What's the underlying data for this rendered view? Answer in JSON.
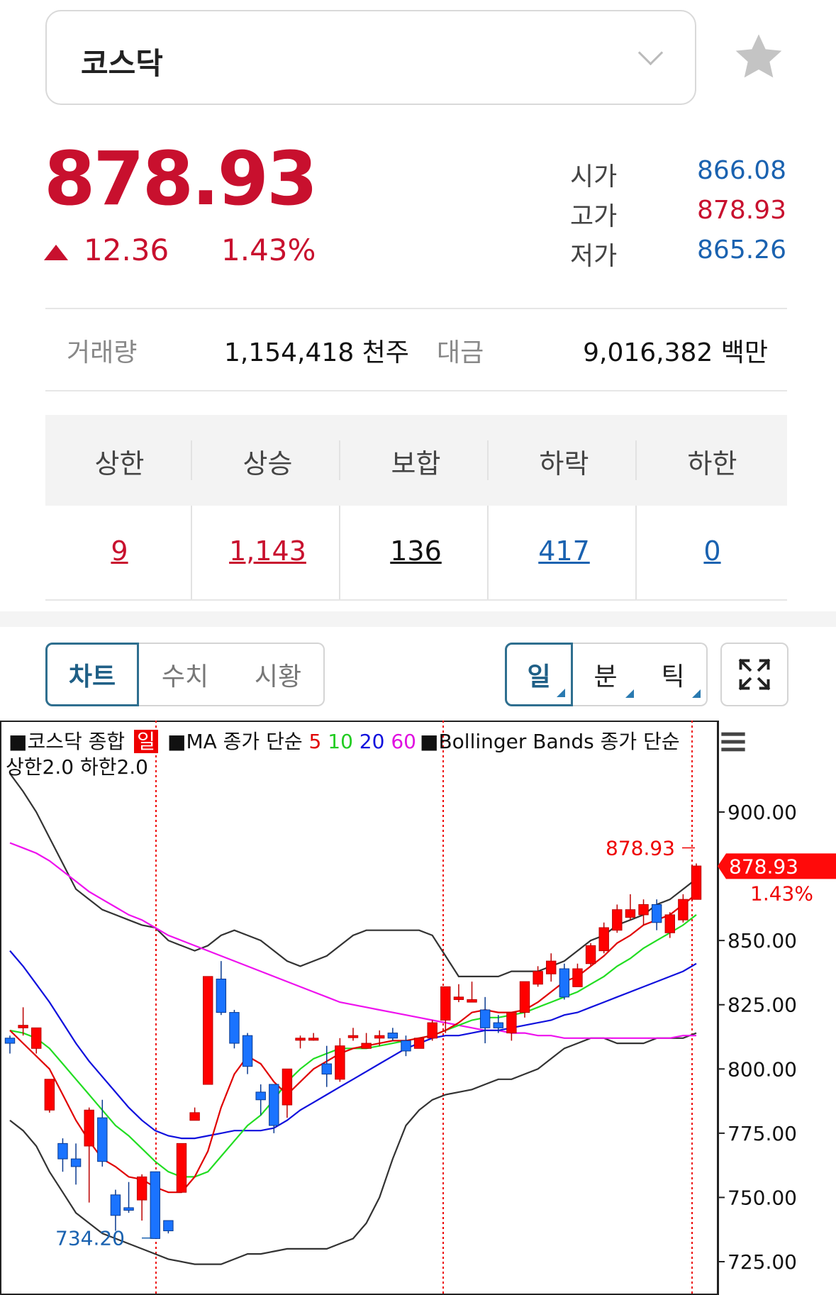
{
  "header": {
    "index_name": "코스닥"
  },
  "quote": {
    "price": "878.93",
    "change": "12.36",
    "change_pct": "1.43%",
    "open_label": "시가",
    "open": "866.08",
    "high_label": "고가",
    "high": "878.93",
    "low_label": "저가",
    "low": "865.26"
  },
  "volume": {
    "volume_label": "거래량",
    "volume_value": "1,154,418 천주",
    "amount_label": "대금",
    "amount_value": "9,016,382 백만"
  },
  "breadth": {
    "headers": [
      "상한",
      "상승",
      "보합",
      "하락",
      "하한"
    ],
    "values": [
      "9",
      "1,143",
      "136",
      "417",
      "0"
    ]
  },
  "chart_tabs": {
    "chart": "차트",
    "numbers": "수치",
    "market": "시황"
  },
  "period_tabs": {
    "day": "일",
    "minute": "분",
    "tick": "틱"
  },
  "legend": {
    "series": "■코스닥 종합",
    "period_badge": "일",
    "ma": "■MA 종가 단순",
    "ma5": "5",
    "ma10": "10",
    "ma20": "20",
    "ma60": "60",
    "bb": "■Bollinger Bands 종가 단순",
    "bb2": "상한2.0 하한2.0"
  },
  "colors": {
    "up": "#c8102e",
    "down": "#1a62b0",
    "candle_up": "#ff0000",
    "candle_down": "#1a73ff"
  },
  "chart_data": {
    "type": "candlestick",
    "y_ticks": [
      "900.00",
      "850.00",
      "825.00",
      "800.00",
      "775.00",
      "750.00",
      "725.00"
    ],
    "ylim": [
      722,
      912
    ],
    "last_price_label": "878.93",
    "last_pct_label": "1.43%",
    "high_marker": "878.93",
    "low_marker": "734.20",
    "candles": [
      [
        812,
        810,
        813,
        806
      ],
      [
        816,
        817,
        824,
        813
      ],
      [
        808,
        816,
        816,
        806
      ],
      [
        784,
        796,
        796,
        783
      ],
      [
        771,
        765,
        773,
        760
      ],
      [
        765,
        762,
        771,
        755
      ],
      [
        770,
        784,
        785,
        748
      ],
      [
        781,
        764,
        788,
        762
      ],
      [
        751,
        743,
        753,
        737
      ],
      [
        746,
        745,
        756,
        744
      ],
      [
        749,
        758,
        759,
        741
      ],
      [
        760,
        734,
        760,
        734
      ],
      [
        741,
        737,
        741,
        736
      ],
      [
        752,
        771,
        771,
        752
      ],
      [
        780,
        783,
        785,
        780
      ],
      [
        794,
        836,
        836,
        794
      ],
      [
        835,
        822,
        842,
        821
      ],
      [
        822,
        810,
        823,
        808
      ],
      [
        813,
        801,
        814,
        798
      ],
      [
        791,
        788,
        794,
        782
      ],
      [
        794,
        778,
        794,
        775
      ],
      [
        786,
        800,
        800,
        781
      ],
      [
        812,
        812,
        813,
        808
      ],
      [
        812,
        812,
        814,
        811
      ],
      [
        802,
        798,
        809,
        793
      ],
      [
        796,
        809,
        812,
        795
      ],
      [
        813,
        813,
        816,
        811
      ],
      [
        808,
        810,
        814,
        808
      ],
      [
        812,
        813,
        815,
        809
      ],
      [
        814,
        812,
        816,
        811
      ],
      [
        811,
        807,
        813,
        805
      ],
      [
        808,
        812,
        812,
        808
      ],
      [
        812,
        818,
        819,
        811
      ],
      [
        819,
        832,
        832,
        814
      ],
      [
        827,
        828,
        833,
        826
      ],
      [
        826,
        827,
        834,
        826
      ],
      [
        823,
        816,
        828,
        810
      ],
      [
        818,
        816,
        821,
        814
      ],
      [
        814,
        822,
        822,
        811
      ],
      [
        822,
        834,
        834,
        820
      ],
      [
        833,
        838,
        840,
        832
      ],
      [
        837,
        842,
        845,
        834
      ],
      [
        839,
        828,
        841,
        827
      ],
      [
        832,
        839,
        841,
        832
      ],
      [
        841,
        848,
        849,
        840
      ],
      [
        846,
        855,
        857,
        845
      ],
      [
        854,
        862,
        864,
        853
      ],
      [
        859,
        862,
        868,
        858
      ],
      [
        860,
        864,
        866,
        856
      ],
      [
        864,
        857,
        866,
        854
      ],
      [
        853,
        860,
        861,
        851
      ],
      [
        858,
        866,
        868,
        857
      ],
      [
        866,
        879,
        880,
        866
      ]
    ],
    "ma5": [
      815,
      810,
      805,
      800,
      790,
      780,
      772,
      765,
      762,
      758,
      757,
      754,
      752,
      752,
      758,
      768,
      785,
      798,
      805,
      802,
      795,
      790,
      795,
      800,
      803,
      806,
      808,
      809,
      810,
      811,
      811,
      812,
      813,
      815,
      818,
      822,
      823,
      822,
      822,
      823,
      826,
      830,
      834,
      836,
      840,
      844,
      849,
      852,
      856,
      858,
      860,
      864,
      868
    ],
    "ma10": [
      815,
      814,
      812,
      808,
      802,
      796,
      790,
      784,
      778,
      774,
      769,
      764,
      760,
      758,
      758,
      760,
      766,
      772,
      778,
      782,
      788,
      795,
      800,
      804,
      806,
      808,
      808,
      808,
      809,
      810,
      811,
      812,
      813,
      815,
      817,
      819,
      820,
      820,
      821,
      822,
      824,
      826,
      828,
      830,
      833,
      836,
      840,
      843,
      847,
      850,
      853,
      856,
      860
    ],
    "ma20": [
      846,
      840,
      833,
      826,
      818,
      810,
      803,
      797,
      791,
      785,
      780,
      776,
      774,
      773,
      773,
      774,
      775,
      776,
      776,
      776,
      777,
      780,
      784,
      787,
      790,
      793,
      796,
      799,
      802,
      805,
      808,
      810,
      812,
      813,
      813,
      814,
      815,
      815,
      816,
      817,
      818,
      819,
      821,
      822,
      824,
      826,
      828,
      830,
      832,
      834,
      836,
      838,
      841
    ],
    "ma60": [
      888,
      886,
      884,
      881,
      877,
      873,
      869,
      866,
      863,
      860,
      858,
      855,
      852,
      850,
      848,
      846,
      844,
      842,
      840,
      838,
      836,
      834,
      832,
      830,
      828,
      826,
      825,
      824,
      823,
      822,
      821,
      820,
      819,
      818,
      817,
      816,
      815,
      815,
      814,
      814,
      813,
      813,
      812,
      812,
      812,
      812,
      812,
      812,
      812,
      812,
      812,
      813,
      813
    ],
    "bb_upper": [
      915,
      908,
      900,
      890,
      880,
      870,
      866,
      862,
      860,
      858,
      856,
      855,
      850,
      848,
      846,
      848,
      852,
      854,
      852,
      850,
      846,
      842,
      840,
      842,
      844,
      848,
      852,
      854,
      854,
      854,
      854,
      854,
      852,
      844,
      836,
      836,
      836,
      836,
      838,
      838,
      838,
      840,
      842,
      846,
      850,
      852,
      856,
      858,
      860,
      864,
      866,
      870,
      874
    ],
    "bb_lower": [
      780,
      776,
      770,
      760,
      752,
      744,
      740,
      736,
      734,
      732,
      730,
      728,
      726,
      725,
      724,
      724,
      724,
      726,
      728,
      728,
      729,
      730,
      730,
      730,
      730,
      732,
      734,
      740,
      750,
      765,
      778,
      784,
      788,
      790,
      791,
      792,
      794,
      796,
      796,
      798,
      800,
      804,
      808,
      810,
      812,
      812,
      810,
      810,
      810,
      812,
      812,
      812,
      814
    ]
  }
}
